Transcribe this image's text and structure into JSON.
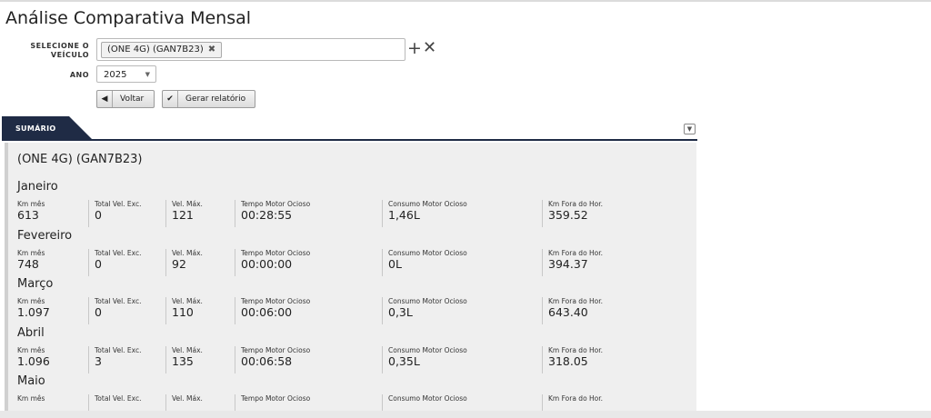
{
  "page": {
    "title": "Análise Comparativa Mensal"
  },
  "form": {
    "vehicle_label_line1": "SELECIONE O",
    "vehicle_label_line2": "VEÍCULO",
    "vehicle_chip": "(ONE 4G) (GAN7B23)",
    "add_symbol": "+",
    "clear_symbol": "✕",
    "year_label": "ANO",
    "year_value": "2025"
  },
  "buttons": {
    "back_label": "Voltar",
    "report_label": "Gerar relatório"
  },
  "summary": {
    "tab_label": "SUMÁRIO",
    "vehicle": "(ONE 4G) (GAN7B23)",
    "columns": {
      "km": "Km mês",
      "speed_exc": "Total Vel. Exc.",
      "max_speed": "Vel. Máx.",
      "idle_time": "Tempo Motor Ocioso",
      "idle_consumption": "Consumo Motor Ocioso",
      "km_off_hours": "Km Fora do Hor."
    },
    "months": [
      {
        "name": "Janeiro",
        "km": "613",
        "speed_exc": "0",
        "max_speed": "121",
        "idle_time": "00:28:55",
        "idle_consumption": "1,46L",
        "km_off_hours": "359.52"
      },
      {
        "name": "Fevereiro",
        "km": "748",
        "speed_exc": "0",
        "max_speed": "92",
        "idle_time": "00:00:00",
        "idle_consumption": "0L",
        "km_off_hours": "394.37"
      },
      {
        "name": "Março",
        "km": "1.097",
        "speed_exc": "0",
        "max_speed": "110",
        "idle_time": "00:06:00",
        "idle_consumption": "0,3L",
        "km_off_hours": "643.40"
      },
      {
        "name": "Abril",
        "km": "1.096",
        "speed_exc": "3",
        "max_speed": "135",
        "idle_time": "00:06:58",
        "idle_consumption": "0,35L",
        "km_off_hours": "318.05"
      },
      {
        "name": "Maio",
        "km": "",
        "speed_exc": "",
        "max_speed": "",
        "idle_time": "",
        "idle_consumption": "",
        "km_off_hours": ""
      }
    ]
  }
}
